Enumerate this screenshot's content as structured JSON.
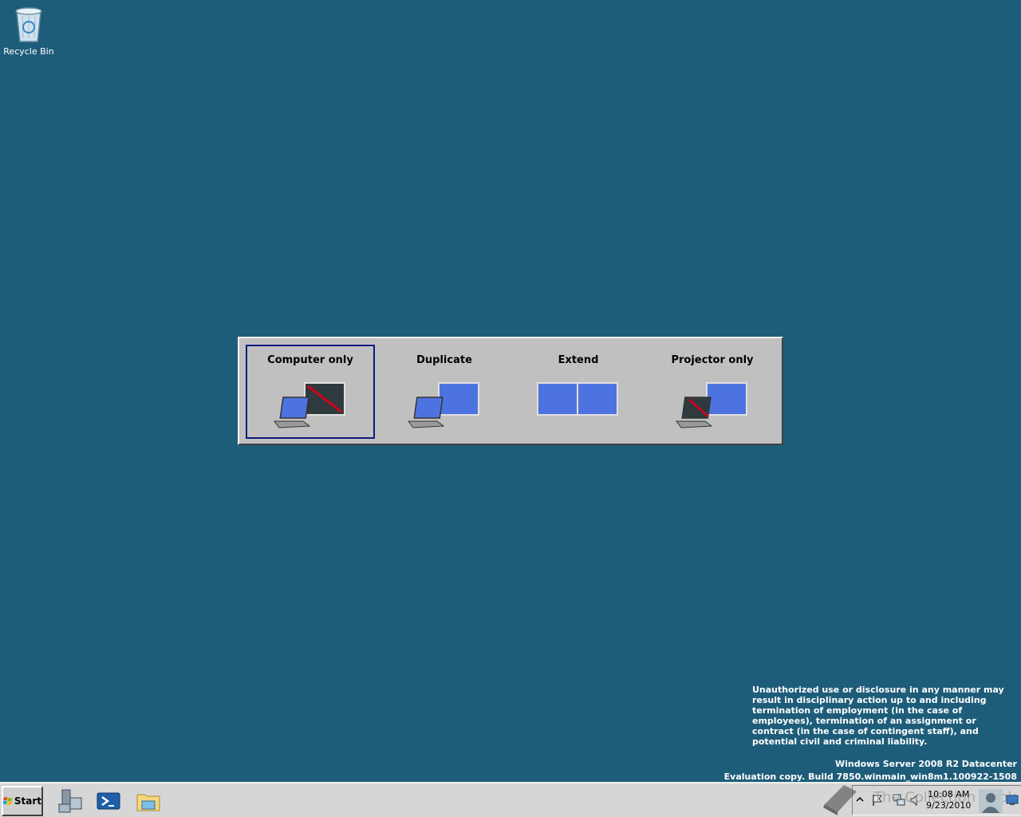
{
  "desktop": {
    "recycle_bin_label": "Recycle Bin"
  },
  "projection": {
    "options": [
      {
        "label": "Computer only",
        "selected": true
      },
      {
        "label": "Duplicate",
        "selected": false
      },
      {
        "label": "Extend",
        "selected": false
      },
      {
        "label": "Projector only",
        "selected": false
      }
    ]
  },
  "legal": {
    "text": "Unauthorized use or disclosure in any manner may result in disciplinary action up to and including termination of employment (in the case of employees), termination of an assignment or contract (in the case of contingent staff), and potential civil and criminal liability."
  },
  "build": {
    "edition": "Windows Server 2008 R2 Datacenter",
    "evaluation": "Evaluation copy. Build 7850.winmain_win8m1.100922-1508"
  },
  "taskbar": {
    "start_label": "Start",
    "pinned": [
      "server-manager-icon",
      "powershell-icon",
      "windows-explorer-icon"
    ],
    "tray": {
      "watermark": "The Collection Book",
      "time": "10:08 AM",
      "date": "9/23/2010"
    }
  },
  "colors": {
    "desktop": "#1e5d7a",
    "selection_border": "#0b1d7d",
    "monitor_blue": "#4d73e0",
    "disabled_line": "#d4001a"
  }
}
